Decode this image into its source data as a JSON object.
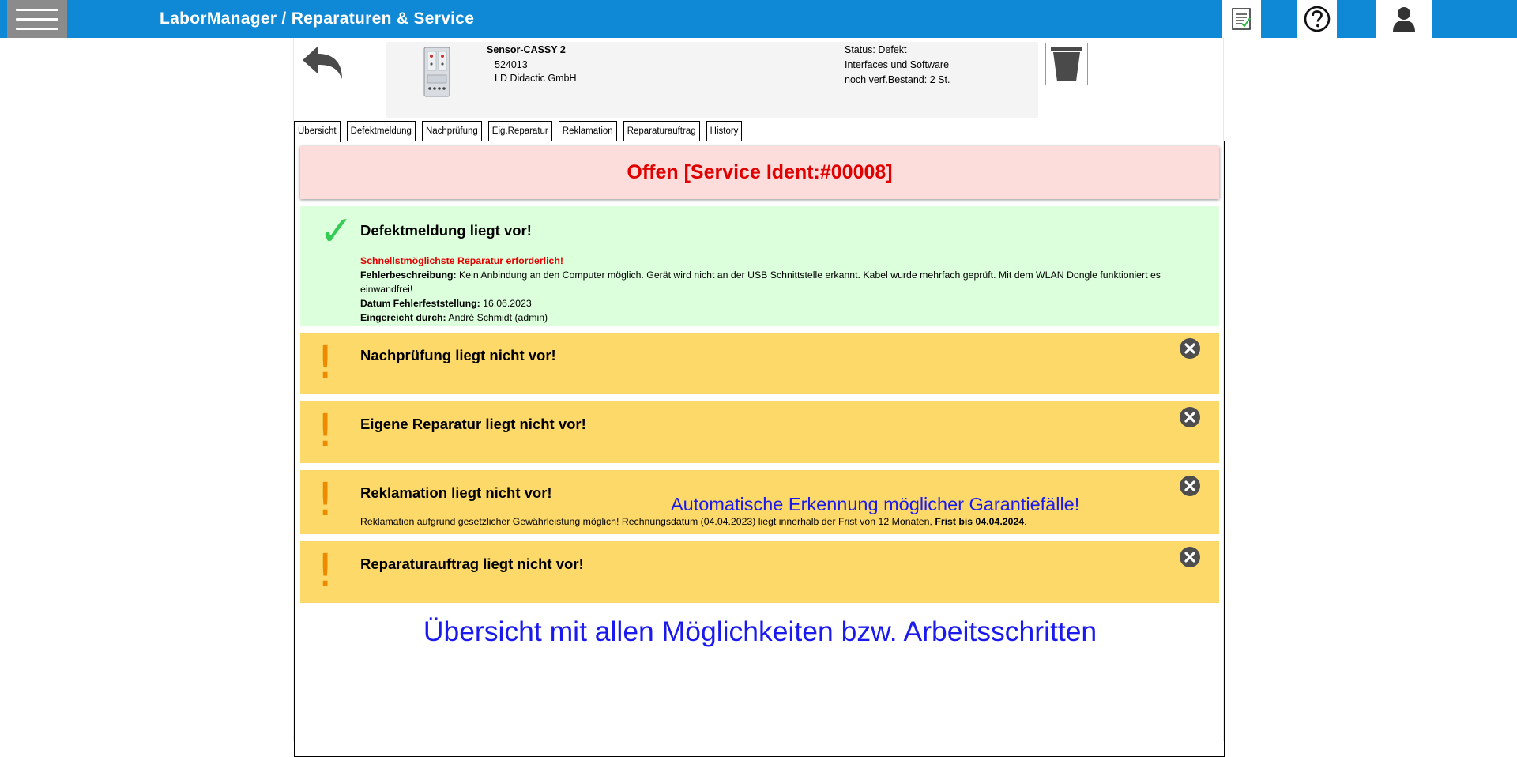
{
  "app": {
    "title": "LaborManager /  Reparaturen & Service"
  },
  "topbar": {
    "icons": [
      "checklist-icon",
      "help-icon",
      "user-icon"
    ]
  },
  "device": {
    "name": "Sensor-CASSY 2",
    "number": "524013",
    "manufacturer": "LD Didactic GmbH",
    "status": "Status: Defekt",
    "category": "Interfaces und Software",
    "stock": "noch verf.Bestand: 2 St."
  },
  "tabs": [
    {
      "label": "Übersicht",
      "active": true
    },
    {
      "label": "Defektmeldung"
    },
    {
      "label": "Nachprüfung"
    },
    {
      "label": "Eig.Reparatur"
    },
    {
      "label": "Reklamation"
    },
    {
      "label": "Reparaturauftrag"
    },
    {
      "label": "History"
    }
  ],
  "status_banner": "Offen [Service Ident:#00008]",
  "defect": {
    "title": "Defektmeldung liegt vor!",
    "urgent": "Schnellstmöglichste Reparatur erforderlich!",
    "desc_label": "Fehlerbeschreibung:",
    "desc_text": "Kein Anbindung an den Computer möglich. Gerät wird nicht an der USB Schnittstelle erkannt. Kabel wurde mehrfach geprüft. Mit dem WLAN Dongle funktioniert es einwandfrei!",
    "date_label": "Datum Fehlerfeststellung:",
    "date_value": "16.06.2023",
    "by_label": "Eingereicht durch:",
    "by_value": "André Schmidt (admin)"
  },
  "checks": {
    "nachpruefung": "Nachprüfung liegt nicht vor!",
    "eigene": "Eigene Reparatur liegt nicht vor!",
    "reklamation": "Reklamation liegt nicht vor!",
    "auftrag": "Reparaturauftrag liegt nicht vor!"
  },
  "reklamation_note": {
    "text": "Reklamation aufgrund gesetzlicher Gewährleistung möglich! Rechnungsdatum (04.04.2023) liegt innerhalb der Frist von 12 Monaten,",
    "deadline": "Frist bis 04.04.2024",
    "end": "."
  },
  "annotations": {
    "warranty": "Automatische Erkennung möglicher Garantiefälle!",
    "overview": "Übersicht mit allen Möglichkeiten bzw. Arbeitsschritten"
  },
  "colors": {
    "topbar": "#0f88d6",
    "error_text": "#e00000",
    "ok_bg": "#dcffdc",
    "warn_bg": "#fdd96a",
    "annotation": "#1a1aee"
  }
}
